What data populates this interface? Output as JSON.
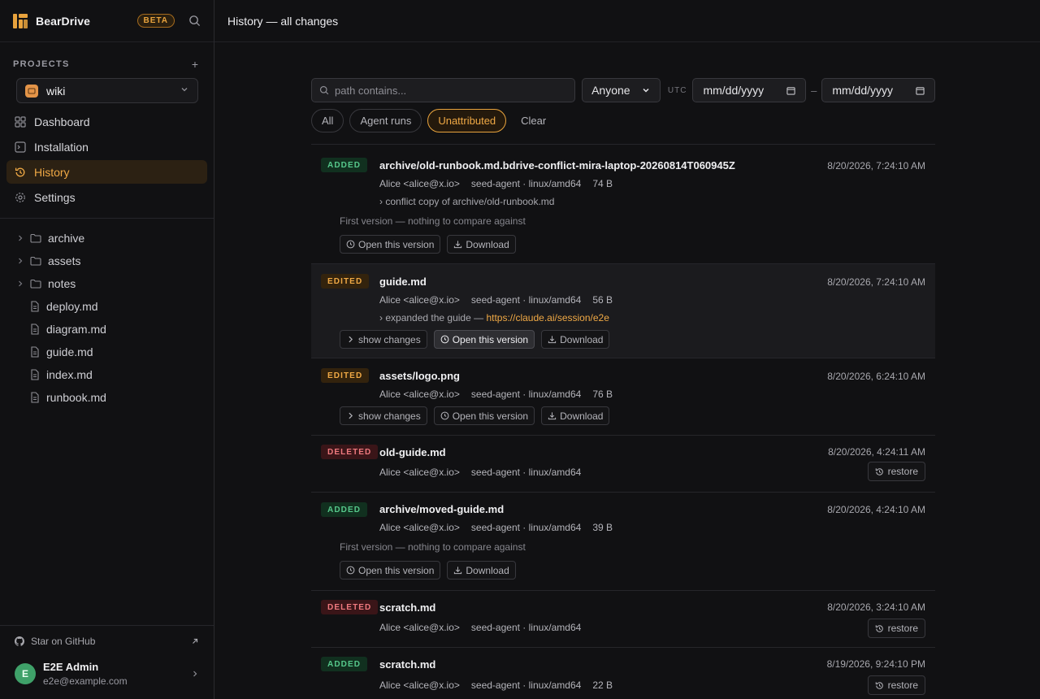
{
  "app": {
    "name": "BearDrive",
    "badge": "BETA"
  },
  "sidebar": {
    "projects_label": "PROJECTS",
    "project": "wiki",
    "nav": [
      {
        "label": "Dashboard",
        "icon": "dashboard-icon"
      },
      {
        "label": "Installation",
        "icon": "terminal-icon"
      },
      {
        "label": "History",
        "icon": "history-icon",
        "active": true
      },
      {
        "label": "Settings",
        "icon": "gear-icon"
      }
    ],
    "folders": [
      "archive",
      "assets",
      "notes"
    ],
    "files": [
      "deploy.md",
      "diagram.md",
      "guide.md",
      "index.md",
      "runbook.md"
    ],
    "github": "Star on GitHub",
    "user": {
      "initial": "E",
      "name": "E2E Admin",
      "email": "e2e@example.com"
    }
  },
  "header": {
    "title": "History — all changes"
  },
  "filters": {
    "path_placeholder": "path contains...",
    "who": "Anyone",
    "utc": "UTC",
    "date_from": "mm/dd/yyyy",
    "date_to": "mm/dd/yyyy",
    "dash": "–",
    "chips": [
      "All",
      "Agent runs",
      "Unattributed"
    ],
    "selected_chip": "Unattributed",
    "clear": "Clear"
  },
  "labels": {
    "open": "Open this version",
    "download": "Download",
    "show_changes": "show changes",
    "restore": "restore",
    "first_version": "First version — nothing to compare against"
  },
  "entries": [
    {
      "kind": "ADDED",
      "path": "archive/old-runbook.md.bdrive-conflict-mira-laptop-20260814T060945Z",
      "time": "8/20/2026, 7:24:10 AM",
      "author": "Alice <alice@x.io>",
      "agent": "seed-agent · linux/amd64",
      "size": "74 B",
      "message": "conflict copy of archive/old-runbook.md"
    },
    {
      "kind": "EDITED",
      "path": "guide.md",
      "time": "8/20/2026, 7:24:10 AM",
      "author": "Alice <alice@x.io>",
      "agent": "seed-agent · linux/amd64",
      "size": "56 B",
      "message": "expanded the guide — ",
      "link": "https://claude.ai/session/e2e"
    },
    {
      "kind": "EDITED",
      "path": "assets/logo.png",
      "time": "8/20/2026, 6:24:10 AM",
      "author": "Alice <alice@x.io>",
      "agent": "seed-agent · linux/amd64",
      "size": "76 B"
    },
    {
      "kind": "DELETED",
      "path": "old-guide.md",
      "time": "8/20/2026, 4:24:11 AM",
      "author": "Alice <alice@x.io>",
      "agent": "seed-agent · linux/amd64"
    },
    {
      "kind": "ADDED",
      "path": "archive/moved-guide.md",
      "time": "8/20/2026, 4:24:10 AM",
      "author": "Alice <alice@x.io>",
      "agent": "seed-agent · linux/amd64",
      "size": "39 B"
    },
    {
      "kind": "DELETED",
      "path": "scratch.md",
      "time": "8/20/2026, 3:24:10 AM",
      "author": "Alice <alice@x.io>",
      "agent": "seed-agent · linux/amd64"
    },
    {
      "kind": "ADDED",
      "path": "scratch.md",
      "time": "8/19/2026, 9:24:10 PM",
      "author": "Alice <alice@x.io>",
      "agent": "seed-agent · linux/amd64",
      "size": "22 B"
    }
  ],
  "colors": {
    "accent": "#e8a33d",
    "added": "#56c88b",
    "deleted": "#f07a7f",
    "background": "#111113"
  }
}
